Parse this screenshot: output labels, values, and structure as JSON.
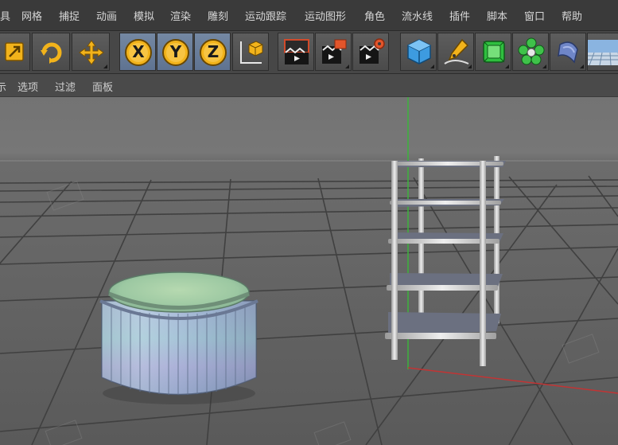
{
  "menu": [
    "具",
    "网格",
    "捕捉",
    "动画",
    "模拟",
    "渲染",
    "雕刻",
    "运动跟踪",
    "运动图形",
    "角色",
    "流水线",
    "插件",
    "脚本",
    "窗口",
    "帮助"
  ],
  "toolbar": {
    "x_axis": "X",
    "y_axis": "Y",
    "z_axis": "Z",
    "icons": [
      "scale-icon",
      "rotate-icon",
      "move-icon",
      "x-axis-lock",
      "y-axis-lock",
      "z-axis-lock",
      "world-coordinates-icon",
      "render-view-icon",
      "render-to-picture-viewer-icon",
      "render-settings-icon",
      "cube-icon",
      "pen-spline-icon",
      "subdivision-surface-icon",
      "cloner-icon",
      "deformer-icon",
      "floor-icon"
    ]
  },
  "view_menu": [
    "示",
    "选项",
    "过滤",
    "面板"
  ],
  "viewport": {
    "objects": [
      "stool",
      "shelf"
    ],
    "colors": {
      "background": "#737373",
      "grid": "#3f3f3f",
      "y_axis_line": "#3cb33c",
      "x_axis_line": "#c23434",
      "shelf_plate": "#6b7080",
      "shelf_pole": "#d9d9d9"
    }
  }
}
